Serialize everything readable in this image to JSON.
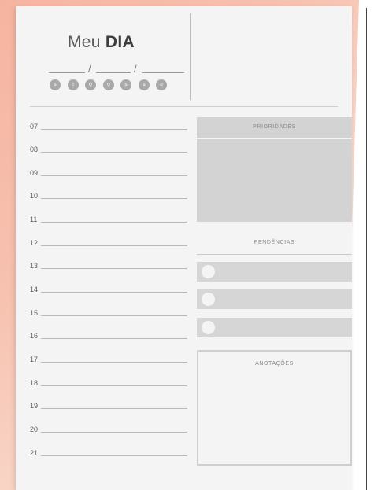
{
  "header": {
    "title_regular": "Meu",
    "title_bold": "DIA",
    "date_separator": "/",
    "weekdays": [
      "S",
      "T",
      "Q",
      "Q",
      "S",
      "S",
      "D"
    ]
  },
  "hours": [
    "07",
    "08",
    "09",
    "10",
    "11",
    "12",
    "13",
    "14",
    "15",
    "16",
    "17",
    "18",
    "19",
    "20",
    "21"
  ],
  "sections": {
    "priorities_label": "PRIORIDADES",
    "pending_label": "PENDÊNCIAS",
    "notes_label": "ANOTAÇÕES"
  },
  "pending_count": 3,
  "colors": {
    "background_accent": "#f6b4a0",
    "paper": "#f4f4f4",
    "block_gray": "#d3d3d3"
  }
}
